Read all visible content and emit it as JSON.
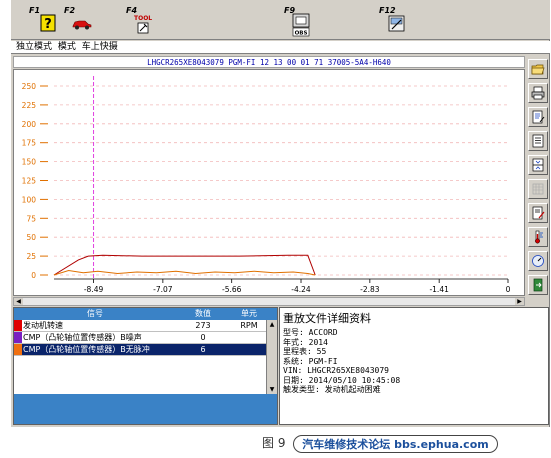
{
  "toolbar": {
    "keys": [
      {
        "key": "F1",
        "icon": "help-icon"
      },
      {
        "key": "F2",
        "icon": "car-icon"
      },
      {
        "key": "F4",
        "icon": "tool-icon",
        "caption": "TOOL"
      },
      {
        "key": "F9",
        "icon": "obd-icon",
        "caption": "OBS"
      },
      {
        "key": "F12",
        "icon": "snapshot-icon"
      }
    ]
  },
  "modebar": {
    "items": [
      "独立模式",
      "模式",
      "车上快摄"
    ]
  },
  "infobar": {
    "text": "LHGCR265XE8043079  PGM-FI  12 13 00 01 71  37005-5A4-H640"
  },
  "chart_data": {
    "type": "line",
    "y_ticks": [
      "250",
      "225",
      "200",
      "175",
      "150",
      "125",
      "100",
      "75",
      "50",
      "25",
      "0"
    ],
    "x_ticks": [
      "-8.49",
      "-7.07",
      "-5.66",
      "-4.24",
      "-2.83",
      "-1.41",
      "0"
    ],
    "ylim": [
      0,
      250
    ],
    "xlim": [
      -9.3,
      0
    ],
    "grid": "horizontal dashed",
    "cursor_x": -8.49,
    "series": [
      {
        "color": "#b00000",
        "x": [
          -9.3,
          -8.8,
          -8.6,
          -8.3,
          -7.5,
          -6.5,
          -5.5,
          -4.5,
          -4.1,
          -3.95
        ],
        "y": [
          0,
          20,
          25,
          26,
          25,
          25,
          25,
          26,
          26,
          0
        ]
      },
      {
        "color": "#e07000",
        "x": [
          -9.3,
          -9.0,
          -8.7,
          -8.4,
          -8.0,
          -7.6,
          -7.2,
          -6.8,
          -6.4,
          -6.0,
          -5.6,
          -5.2,
          -4.8,
          -4.4,
          -4.1,
          -3.95
        ],
        "y": [
          0,
          6,
          3,
          5,
          2,
          4,
          3,
          5,
          2,
          4,
          3,
          5,
          3,
          4,
          2,
          0
        ]
      }
    ]
  },
  "table": {
    "headers": {
      "name": "信号",
      "value": "数值",
      "unit": "单元"
    },
    "rows": [
      {
        "name": "发动机转速",
        "value": "273",
        "unit": "RPM",
        "color": "#e00000"
      },
      {
        "name": "CMP（凸轮轴位置传感器）B噪声",
        "value": "0",
        "unit": "",
        "color": "#7a1fc2"
      },
      {
        "name": "CMP（凸轮轴位置传感器）B无脉冲",
        "value": "6",
        "unit": "",
        "color": "#f07010"
      }
    ]
  },
  "detail": {
    "title": "重放文件详细资料",
    "lines": [
      "型号: ACCORD",
      "年式: 2014",
      "里程表: 55",
      "系统: PGM-FI",
      "VIN: LHGCR265XE8043079",
      "日期: 2014/05/10 10:45:08",
      "触发类型: 发动机起动困难"
    ]
  },
  "caption": {
    "figure": "图 9",
    "site": "汽车维修技术论坛 bbs.ephua.com"
  }
}
